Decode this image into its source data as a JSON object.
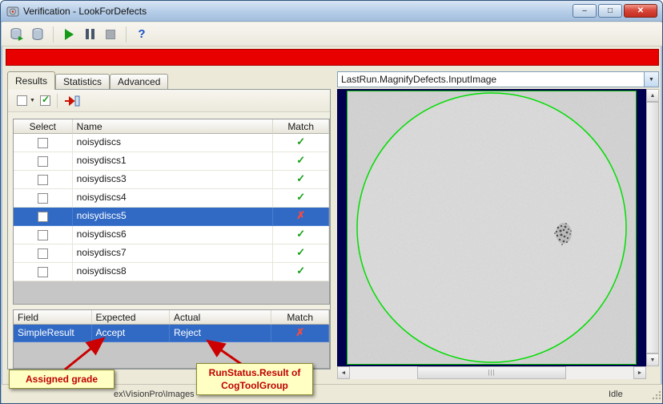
{
  "window": {
    "title": "Verification - LookForDefects",
    "buttons": {
      "minimize": "–",
      "maximize": "□",
      "close": "✕"
    }
  },
  "toolbar": {
    "help_glyph": "?"
  },
  "tabs": {
    "results": "Results",
    "statistics": "Statistics",
    "advanced": "Advanced"
  },
  "results_table": {
    "headers": {
      "select": "Select",
      "name": "Name",
      "match": "Match"
    },
    "rows": [
      {
        "name": "noisydiscs",
        "mark": "✓",
        "state": "pass",
        "selected": "false"
      },
      {
        "name": "noisydiscs1",
        "mark": "✓",
        "state": "pass",
        "selected": "false"
      },
      {
        "name": "noisydiscs3",
        "mark": "✓",
        "state": "pass",
        "selected": "false"
      },
      {
        "name": "noisydiscs4",
        "mark": "✓",
        "state": "pass",
        "selected": "false"
      },
      {
        "name": "noisydiscs5",
        "mark": "✗",
        "state": "fail",
        "selected": "true"
      },
      {
        "name": "noisydiscs6",
        "mark": "✓",
        "state": "pass",
        "selected": "false"
      },
      {
        "name": "noisydiscs7",
        "mark": "✓",
        "state": "pass",
        "selected": "false"
      },
      {
        "name": "noisydiscs8",
        "mark": "✓",
        "state": "pass",
        "selected": "false"
      }
    ]
  },
  "detail_table": {
    "headers": {
      "field": "Field",
      "expected": "Expected",
      "actual": "Actual",
      "match": "Match"
    },
    "row": {
      "field": "SimpleResult",
      "expected": "Accept",
      "actual": "Reject",
      "mark": "✗",
      "state": "fail",
      "selected": "true"
    }
  },
  "callouts": {
    "assigned_grade": "Assigned grade",
    "runstatus": "RunStatus.Result of CogToolGroup"
  },
  "status_bar": {
    "path": "ex\\VisionPro\\Images",
    "state": "Idle"
  },
  "image_panel": {
    "view_selector": "LastRun.MagnifyDefects.InputImage"
  },
  "icons": {
    "dropdown_arrow": "▼",
    "combo_arrow": "▼",
    "scroll_up": "▲",
    "scroll_down": "▼",
    "scroll_left": "◄",
    "scroll_right": "►",
    "grip": "|||"
  },
  "colors": {
    "alert": "#e80000",
    "selection": "#316ac5",
    "pass": "#18a018",
    "fail": "#d81e10",
    "callout_bg": "#ffffc4"
  }
}
